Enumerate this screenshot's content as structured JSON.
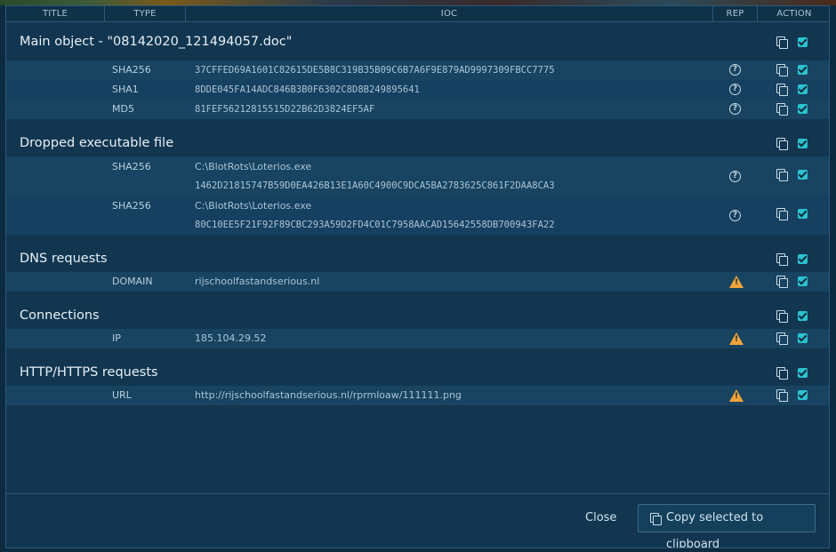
{
  "table": {
    "headers": {
      "title": "TITLE",
      "type": "TYPE",
      "ioc": "IOC",
      "rep": "REP",
      "action": "ACTION"
    }
  },
  "groups": [
    {
      "title": "Main object - \"08142020_121494057.doc\"",
      "rows": [
        {
          "type": "SHA256",
          "ioc": "37CFFED69A1601C82615DE5B8C319B35B09C6B7A6F9E879AD9997309FBCC7775",
          "rep": "unknown"
        },
        {
          "type": "SHA1",
          "ioc": "8DDE045FA14ADC846B3B0F6302C8D8B249895641",
          "rep": "unknown"
        },
        {
          "type": "MD5",
          "ioc": "81FEF56212815515D22B62D3824EF5AF",
          "rep": "unknown"
        }
      ]
    },
    {
      "title": "Dropped executable file",
      "rows": [
        {
          "type": "SHA256",
          "path": "C:\\BlotRots\\Loterios.exe",
          "ioc": "1462D21815747B59D0EA426B13E1A60C4900C9DCA5BA2783625C861F2DAA8CA3",
          "rep": "unknown"
        },
        {
          "type": "SHA256",
          "path": "C:\\BlotRots\\Loterios.exe",
          "ioc": "80C10EE5F21F92F89CBC293A59D2FD4C01C7958AACAD15642558DB700943FA22",
          "rep": "unknown"
        }
      ]
    },
    {
      "title": "DNS requests",
      "rows": [
        {
          "type": "DOMAIN",
          "ioc": "rijschoolfastandserious.nl",
          "rep": "warning"
        }
      ]
    },
    {
      "title": "Connections",
      "rows": [
        {
          "type": "IP",
          "ioc": "185.104.29.52",
          "rep": "warning"
        }
      ]
    },
    {
      "title": "HTTP/HTTPS requests",
      "rows": [
        {
          "type": "URL",
          "ioc": "http://rijschoolfastandserious.nl/rprmloaw/111111.png",
          "rep": "warning"
        }
      ]
    }
  ],
  "icons": {
    "unknown": "question-circle-icon",
    "warning": "warning-triangle-icon",
    "copy": "copy-icon",
    "checkbox": "checkbox-checked"
  },
  "colors": {
    "warning": "#f0a33a",
    "checkbox": "#2cc1cf"
  },
  "footer": {
    "close_label": "Close",
    "copy_label": "Copy selected to clipboard"
  }
}
